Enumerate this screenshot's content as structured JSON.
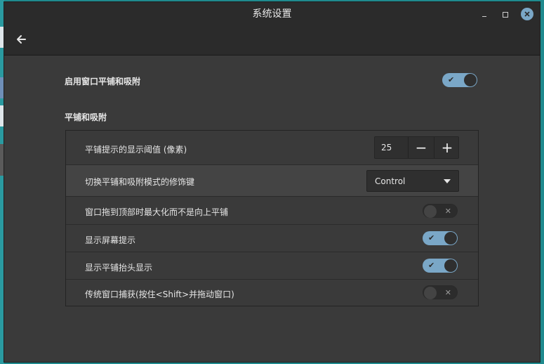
{
  "window": {
    "title": "系统设置"
  },
  "header": {
    "back_icon": "arrow-left-icon"
  },
  "enable": {
    "label": "启用窗口平铺和吸附",
    "on": true
  },
  "section": {
    "title": "平铺和吸附"
  },
  "rows": [
    {
      "label": "平铺提示的显示阈值 (像素)",
      "control": "spin",
      "value": "25",
      "minus": "−",
      "plus": "+"
    },
    {
      "label": "切换平铺和吸附模式的修饰键",
      "control": "combo",
      "value": "Control"
    },
    {
      "label": "窗口拖到顶部时最大化而不是向上平铺",
      "control": "switch",
      "on": false
    },
    {
      "label": "显示屏幕提示",
      "control": "switch",
      "on": true
    },
    {
      "label": "显示平铺抬头显示",
      "control": "switch",
      "on": true
    },
    {
      "label": "传统窗口捕获(按住<Shift>并拖动窗口)",
      "control": "switch",
      "on": false
    }
  ],
  "colors": {
    "accent": "#7aa7c7",
    "window_bg": "#3a3a3a",
    "titlebar_bg": "#2b2b2b"
  }
}
